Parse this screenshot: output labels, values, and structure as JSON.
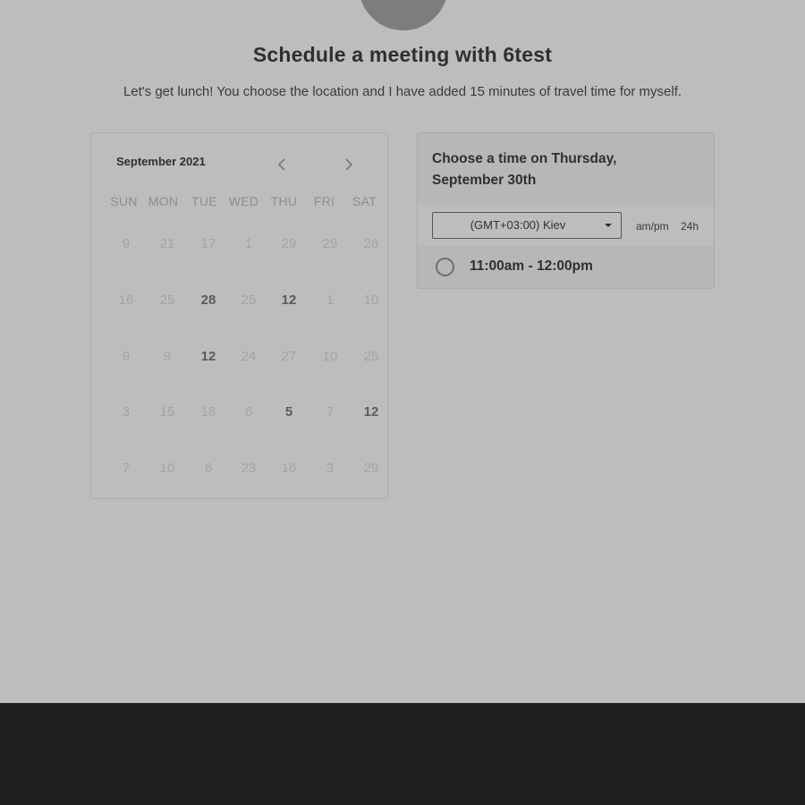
{
  "header": {
    "title": "Schedule a meeting with 6test",
    "description": "Let's get lunch! You choose the location and I have added 15 minutes of travel time for myself."
  },
  "calendar": {
    "month_label": "September 2021",
    "prev_icon": "chevron-left-icon",
    "next_icon": "chevron-right-icon",
    "weekdays": [
      "SUN",
      "MON",
      "TUE",
      "WED",
      "THU",
      "FRI",
      "SAT"
    ],
    "weeks": [
      [
        "9",
        "21",
        "17",
        "1",
        "29",
        "29",
        "26"
      ],
      [
        "16",
        "25",
        "28",
        "25",
        "12",
        "1",
        "10"
      ],
      [
        "9",
        "9",
        "12",
        "24",
        "27",
        "10",
        "25"
      ],
      [
        "3",
        "15",
        "18",
        "6",
        "5",
        "7",
        "12"
      ],
      [
        "7",
        "10",
        "6",
        "23",
        "16",
        "3",
        "29"
      ]
    ],
    "bold_days": [
      [
        1,
        2
      ],
      [
        1,
        4
      ],
      [
        2,
        2
      ],
      [
        3,
        4
      ],
      [
        3,
        6
      ]
    ]
  },
  "time_picker": {
    "header": "Choose a time on Thursday, September 30th",
    "timezone": "(GMT+03:00) Kiev",
    "format_ampm": "am/pm",
    "format_24h": "24h",
    "slots": [
      "11:00am - 12:00pm"
    ]
  },
  "colors": {
    "page_background": "#bdbdbd",
    "footer_background": "#1e1e1e",
    "text_primary": "#2f2f2f"
  }
}
